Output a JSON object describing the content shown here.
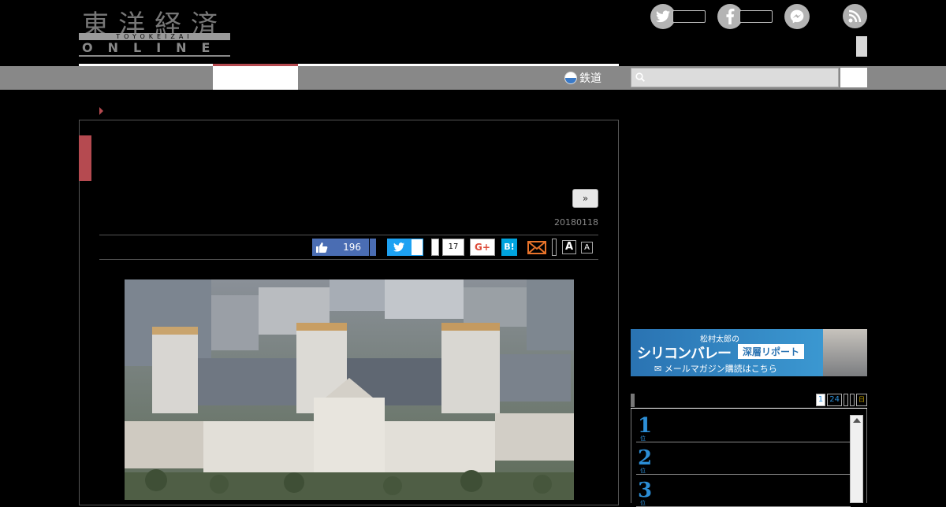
{
  "header": {
    "logo_kanji": "東洋経済",
    "logo_romaji": "TOYOKEIZAI",
    "logo_online": "ONLINE"
  },
  "nav": {
    "rail_label": "鉄道",
    "search_placeholder": ""
  },
  "article": {
    "next_label": "»",
    "date": "20180118",
    "share": {
      "like_count": "196",
      "pocket_count": "17",
      "gplus_label": "G+",
      "hatena_label": "B!",
      "font_large": "A",
      "font_small": "A"
    }
  },
  "sidebar": {
    "banner": {
      "byline": "松村太郎の",
      "title": "シリコンバレー",
      "subtitle": "深層リポート",
      "cta": "✉ メールマガジン購読はこちら"
    },
    "ranking": {
      "tabs": [
        "1",
        "24",
        "",
        "",
        "日"
      ],
      "items": [
        {
          "num": "1",
          "suffix": "位"
        },
        {
          "num": "2",
          "suffix": "位"
        },
        {
          "num": "3",
          "suffix": "位"
        }
      ]
    }
  },
  "colors": {
    "accent_red": "#b54a50",
    "nav_gray": "#888888",
    "facebook": "#4a6db3",
    "twitter": "#1da1f2",
    "hatena": "#00a4de"
  }
}
